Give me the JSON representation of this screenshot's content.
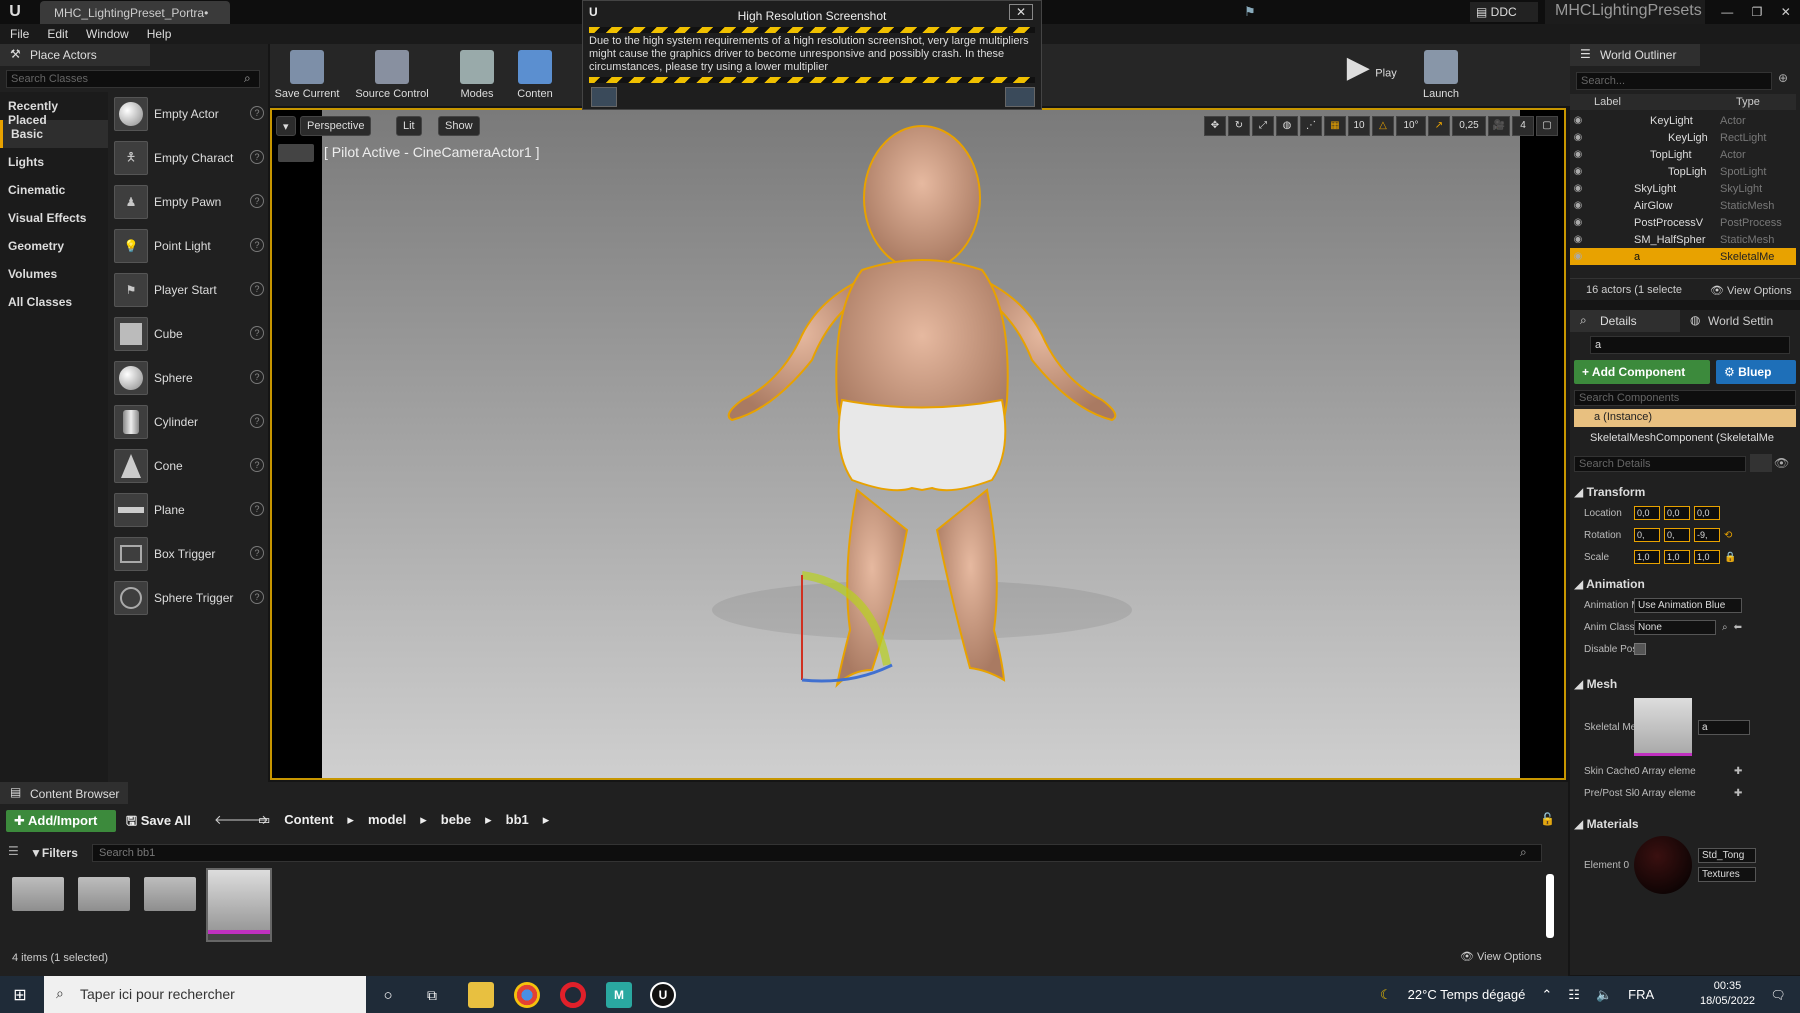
{
  "titlebar": {
    "doc_tab": "MHC_LightingPreset_Portra•",
    "ddc": "DDC",
    "project": "MHCLightingPresets"
  },
  "menu": [
    "File",
    "Edit",
    "Window",
    "Help"
  ],
  "place_actors": {
    "tab": "Place Actors",
    "search_placeholder": "Search Classes",
    "categories": [
      "Recently Placed",
      "Basic",
      "Lights",
      "Cinematic",
      "Visual Effects",
      "Geometry",
      "Volumes",
      "All Classes"
    ],
    "active_category": "Basic",
    "items": [
      "Empty Actor",
      "Empty Charact",
      "Empty Pawn",
      "Point Light",
      "Player Start",
      "Cube",
      "Sphere",
      "Cylinder",
      "Cone",
      "Plane",
      "Box Trigger",
      "Sphere Trigger"
    ]
  },
  "toolbar": {
    "save_current": "Save Current",
    "source_control": "Source Control",
    "modes": "Modes",
    "content": "Conten",
    "play": "Play",
    "launch": "Launch"
  },
  "modal": {
    "title": "High Resolution Screenshot",
    "message": "Due to the high system requirements of a high resolution screenshot, very large multipliers might cause the graphics driver to become unresponsive and possibly crash. In these circumstances, please try using a lower multiplier"
  },
  "viewport": {
    "perspective": "Perspective",
    "lit": "Lit",
    "show": "Show",
    "pilot": "[ Pilot Active - CineCameraActor1 ]",
    "grid_snap": "10",
    "rot_snap": "10°",
    "scale_snap": "0,25",
    "cam_speed": "4"
  },
  "outliner": {
    "tab": "World Outliner",
    "search_placeholder": "Search...",
    "col_label": "Label",
    "col_type": "Type",
    "rows": [
      {
        "label": "KeyLight",
        "type": "Actor"
      },
      {
        "label": "KeyLigh",
        "type": "RectLight"
      },
      {
        "label": "TopLight",
        "type": "Actor"
      },
      {
        "label": "TopLigh",
        "type": "SpotLight"
      },
      {
        "label": "SkyLight",
        "type": "SkyLight"
      },
      {
        "label": "AirGlow",
        "type": "StaticMesh"
      },
      {
        "label": "PostProcessV",
        "type": "PostProcess"
      },
      {
        "label": "SM_HalfSpher",
        "type": "StaticMesh"
      },
      {
        "label": "a",
        "type": "SkeletalMe"
      }
    ],
    "status": "16 actors (1 selecte",
    "view_options": "View Options"
  },
  "details": {
    "tab": "Details",
    "world_tab": "World Settin",
    "name_value": "a",
    "add_component": "+ Add Component",
    "blueprint": "Bluep",
    "search_components": "Search Components",
    "instance": "a (Instance)",
    "component": "SkeletalMeshComponent (SkeletalMe",
    "search_details": "Search Details",
    "transform": "Transform",
    "location": "Location",
    "rotation": "Rotation",
    "scale": "Scale",
    "loc_values": [
      "0,0",
      "0,0",
      "0,0"
    ],
    "rot_values": [
      "0,",
      "0,",
      "-9,"
    ],
    "scale_values": [
      "1,0",
      "1,0",
      "1,0"
    ],
    "animation": "Animation",
    "anim_mode": "Animation M",
    "anim_mode_value": "Use Animation Blue",
    "anim_class": "Anim Class",
    "anim_class_value": "None",
    "disable_post": "Disable Post",
    "mesh": "Mesh",
    "skeletal_mesh": "Skeletal Mes",
    "skeletal_mesh_value": "a",
    "skin_cache": "Skin Cache",
    "skin_cache_value": "0 Array eleme",
    "prepost": "Pre/Post Sk",
    "prepost_value": "0 Array eleme",
    "materials": "Materials",
    "element0": "Element 0",
    "material_value": "Std_Tong",
    "textures": "Textures"
  },
  "content_browser": {
    "tab": "Content Browser",
    "add_import": "Add/Import",
    "save_all": "Save All",
    "breadcrumbs": [
      "Content",
      "model",
      "bebe",
      "bb1"
    ],
    "filters": "Filters",
    "search_placeholder": "Search bb1",
    "count": "4 items (1 selected)",
    "view_options": "View Options"
  },
  "taskbar": {
    "search": "Taper ici pour rechercher",
    "weather": "22°C  Temps dégagé",
    "lang": "FRA",
    "time": "00:35",
    "date": "18/05/2022"
  },
  "colors": {
    "accent": "#e8a200",
    "add_green": "#3c8a3c",
    "blueprint_blue": "#1e6fb8"
  }
}
